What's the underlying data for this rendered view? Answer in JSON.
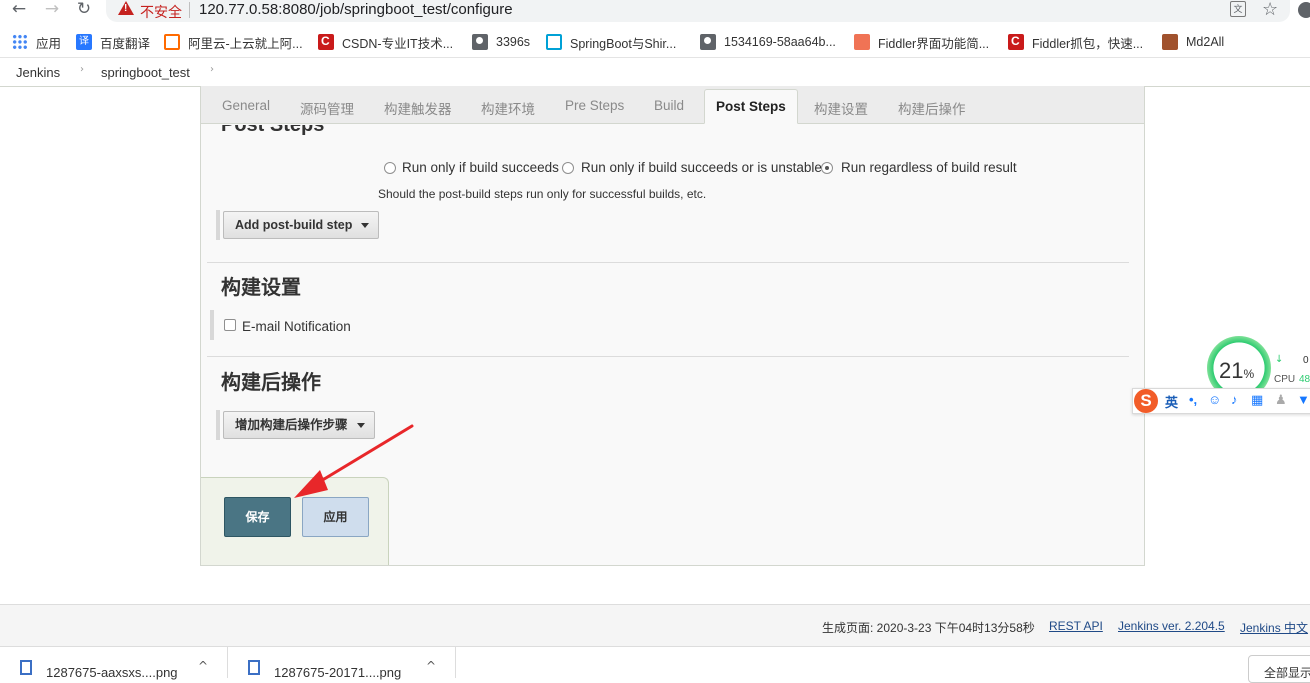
{
  "browser": {
    "back": "←",
    "forward": "→",
    "reload": "↻",
    "security_label": "不安全",
    "url": "120.77.0.58:8080/job/springboot_test/configure",
    "star": "☆",
    "bookmarks": [
      {
        "label": "应用",
        "icon": "apps-icon"
      },
      {
        "label": "百度翻译",
        "icon": "baidu-translate-icon"
      },
      {
        "label": "阿里云-上云就上阿...",
        "icon": "aliyun-icon"
      },
      {
        "label": "CSDN-专业IT技术...",
        "icon": "csdn-icon"
      },
      {
        "label": "3396s",
        "icon": "globe-icon"
      },
      {
        "label": "SpringBoot与Shir...",
        "icon": "bilibili-icon"
      },
      {
        "label": "1534169-58aa64b...",
        "icon": "globe-icon"
      },
      {
        "label": "Fiddler界面功能简...",
        "icon": "jianshu-icon"
      },
      {
        "label": "Fiddler抓包，快速...",
        "icon": "csdn-icon"
      },
      {
        "label": "Md2All",
        "icon": "md2all-icon"
      }
    ]
  },
  "breadcrumb": {
    "root": "Jenkins",
    "job": "springboot_test",
    "sep": "›"
  },
  "tabs": [
    {
      "label": "General"
    },
    {
      "label": "源码管理"
    },
    {
      "label": "构建触发器"
    },
    {
      "label": "构建环境"
    },
    {
      "label": "Pre Steps"
    },
    {
      "label": "Build"
    },
    {
      "label": "Post Steps",
      "active": true
    },
    {
      "label": "构建设置"
    },
    {
      "label": "构建后操作"
    }
  ],
  "post_steps": {
    "title": "Post Steps",
    "options": [
      {
        "label": "Run only if build succeeds",
        "selected": false
      },
      {
        "label": "Run only if build succeeds or is unstable",
        "selected": false
      },
      {
        "label": "Run regardless of build result",
        "selected": true
      }
    ],
    "help": "Should the post-build steps run only for successful builds, etc.",
    "add_button": "Add post-build step"
  },
  "build_settings": {
    "title": "构建设置",
    "email_label": "E-mail Notification",
    "email_checked": false
  },
  "post_build": {
    "title": "构建后操作",
    "add_button": "增加构建后操作步骤"
  },
  "actions": {
    "save": "保存",
    "apply": "应用"
  },
  "footer": {
    "generated": "生成页面: 2020-3-23 下午04时13分58秒",
    "rest_api": "REST API",
    "version": "Jenkins ver. 2.204.5",
    "chinese": "Jenkins 中文"
  },
  "downloads": {
    "items": [
      {
        "name": "1287675-aaxsxs....png"
      },
      {
        "name": "1287675-20171....png"
      }
    ],
    "show_all": "全部显示",
    "caret": "^"
  },
  "widgets": {
    "cpu_percent": "21",
    "percent_sign": "%",
    "net_down": "0",
    "cpu_label": "CPU",
    "cpu_value": "48",
    "ime_lang": "英"
  },
  "colors": {
    "save_button": "#4a7584",
    "apply_button": "#cfdded",
    "annotation_arrow": "#e8272a",
    "insecure_red": "#c5221f"
  }
}
